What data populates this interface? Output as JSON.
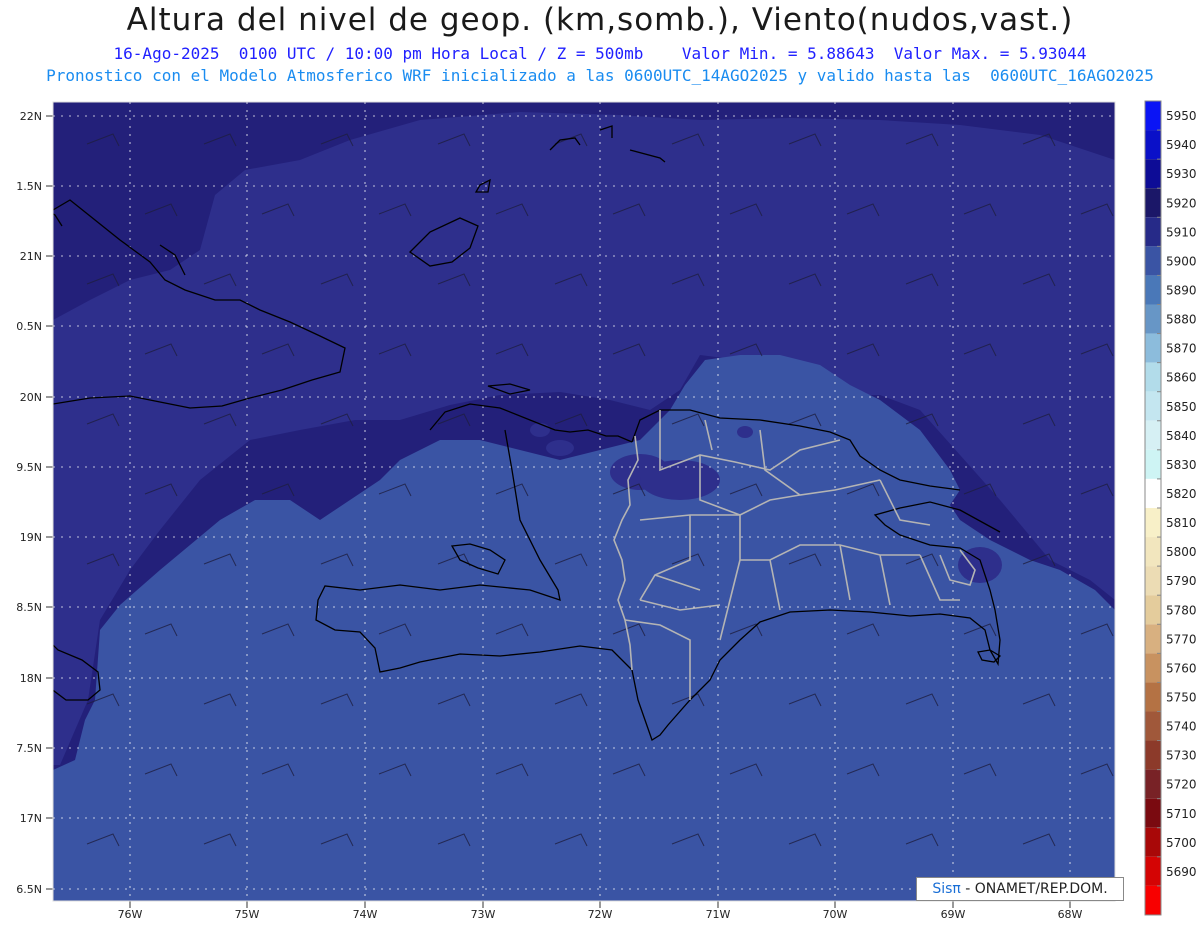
{
  "header": {
    "title": "Altura del nivel de geop. (km,somb.), Viento(nudos,vast.)",
    "subtitle1": "16-Ago-2025  0100 UTC / 10:00 pm Hora Local / Z = 500mb    Valor Min. = 5.88643  Valor Max. = 5.93044",
    "subtitle2": "Pronostico con el Modelo Atmosferico WRF inicializado a las 0600UTC_14AGO2025 y valido hasta las  0600UTC_16AGO2025"
  },
  "map": {
    "lat_labels": [
      "22N",
      "1.5N",
      "21N",
      "0.5N",
      "20N",
      "9.5N",
      "19N",
      "8.5N",
      "18N",
      "7.5N",
      "17N",
      "6.5N"
    ],
    "lon_labels": [
      "76W",
      "75W",
      "74W",
      "73W",
      "72W",
      "71W",
      "70W",
      "69W",
      "68W"
    ],
    "colors": {
      "outer": "#23207a",
      "middle": "#2e2f8c",
      "inner": "#3a54a4",
      "coast": "#000000",
      "provinces": "#b4b4b4",
      "grid": "#ffffff"
    }
  },
  "colorbar": {
    "levels": [
      "5950",
      "5940",
      "5930",
      "5920",
      "5910",
      "5900",
      "5890",
      "5880",
      "5870",
      "5860",
      "5850",
      "5840",
      "5830",
      "5820",
      "5810",
      "5800",
      "5790",
      "5780",
      "5770",
      "5760",
      "5750",
      "5740",
      "5730",
      "5720",
      "5710",
      "5700",
      "5690"
    ],
    "swatch_colors": [
      "#0a14f5",
      "#0a10c8",
      "#0d0c96",
      "#1b1768",
      "#262a88",
      "#3a54a4",
      "#4a78b8",
      "#6796c6",
      "#8cbcdc",
      "#b2dcea",
      "#c4e6f0",
      "#d6f0f4",
      "#cef4f4",
      "#ffffff",
      "#f8f0c8",
      "#f2e6be",
      "#ecdcb4",
      "#e4cc9c",
      "#d8b080",
      "#c89260",
      "#b47244",
      "#a0583a",
      "#8c3a2a",
      "#782226",
      "#7a0a10",
      "#a80808",
      "#d40404",
      "#f80000"
    ]
  },
  "credit": {
    "brand": "Sisπ",
    "text": "- ONAMET/REP.DOM."
  }
}
